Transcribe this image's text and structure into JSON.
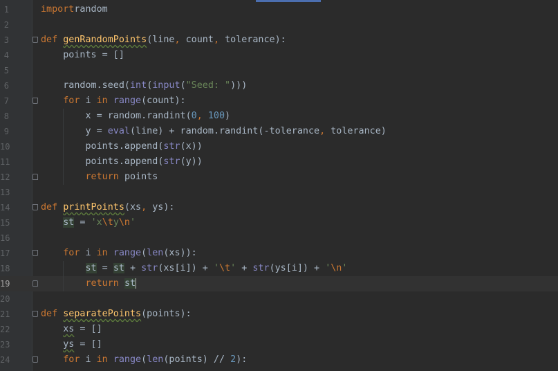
{
  "editor": {
    "language": "python",
    "current_line": 19,
    "colors": {
      "background": "#2b2b2b",
      "keyword": "#cc7832",
      "function": "#ffc66d",
      "number": "#6897bb",
      "string": "#6a8759",
      "builtin": "#8888c6",
      "text": "#a9b7c6"
    },
    "lines": [
      {
        "n": "1",
        "t": [
          [
            "kw",
            "import"
          ],
          [
            "",
            "random"
          ]
        ]
      },
      {
        "n": "2",
        "t": []
      },
      {
        "n": "3",
        "t": [
          [
            "kw",
            "def "
          ],
          [
            "fn uw",
            "genRandomPoints"
          ],
          [
            "",
            "(line"
          ],
          [
            "pu",
            ", "
          ],
          [
            "",
            "count"
          ],
          [
            "pu",
            ", "
          ],
          [
            "",
            "tolerance):"
          ]
        ]
      },
      {
        "n": "4",
        "t": [
          [
            "",
            "    points = []"
          ]
        ]
      },
      {
        "n": "5",
        "t": []
      },
      {
        "n": "6",
        "t": [
          [
            "",
            "    random.seed("
          ],
          [
            "bi",
            "int"
          ],
          [
            "",
            "("
          ],
          [
            "bi",
            "input"
          ],
          [
            "",
            "("
          ],
          [
            "str",
            "\"Seed: \""
          ],
          [
            "",
            ")))"
          ]
        ]
      },
      {
        "n": "7",
        "t": [
          [
            "kw",
            "    for "
          ],
          [
            "",
            "i "
          ],
          [
            "kw",
            "in "
          ],
          [
            "bi",
            "range"
          ],
          [
            "",
            "(count):"
          ]
        ]
      },
      {
        "n": "8",
        "t": [
          [
            "",
            "        x = random.randint("
          ],
          [
            "num",
            "0"
          ],
          [
            "pu",
            ", "
          ],
          [
            "num",
            "100"
          ],
          [
            "",
            ")"
          ]
        ]
      },
      {
        "n": "9",
        "t": [
          [
            "",
            "        y = "
          ],
          [
            "bi",
            "eval"
          ],
          [
            "",
            "(line) + random.randint(-tolerance"
          ],
          [
            "pu",
            ", "
          ],
          [
            "",
            "tolerance)"
          ]
        ]
      },
      {
        "n": "10",
        "t": [
          [
            "",
            "        points.append("
          ],
          [
            "bi",
            "str"
          ],
          [
            "",
            "(x))"
          ]
        ]
      },
      {
        "n": "11",
        "t": [
          [
            "",
            "        points.append("
          ],
          [
            "bi",
            "str"
          ],
          [
            "",
            "(y))"
          ]
        ]
      },
      {
        "n": "12",
        "t": [
          [
            "kw",
            "        return "
          ],
          [
            "",
            "points"
          ]
        ]
      },
      {
        "n": "13",
        "t": []
      },
      {
        "n": "14",
        "t": [
          [
            "kw",
            "def "
          ],
          [
            "fn uw",
            "printPoints"
          ],
          [
            "",
            "(xs"
          ],
          [
            "pu",
            ", "
          ],
          [
            "",
            "ys):"
          ]
        ]
      },
      {
        "n": "15",
        "t": [
          [
            "",
            "    "
          ],
          [
            "hl",
            "st"
          ],
          [
            "",
            " = "
          ],
          [
            "str",
            "'x"
          ],
          [
            "esc",
            "\\t"
          ],
          [
            "str",
            "y"
          ],
          [
            "esc",
            "\\n"
          ],
          [
            "str",
            "'"
          ]
        ]
      },
      {
        "n": "16",
        "t": []
      },
      {
        "n": "17",
        "t": [
          [
            "kw",
            "    for "
          ],
          [
            "",
            "i "
          ],
          [
            "kw",
            "in "
          ],
          [
            "bi",
            "range"
          ],
          [
            "",
            "("
          ],
          [
            "bi",
            "len"
          ],
          [
            "",
            "(xs)):"
          ]
        ]
      },
      {
        "n": "18",
        "t": [
          [
            "",
            "        "
          ],
          [
            "hl",
            "st"
          ],
          [
            "",
            " = "
          ],
          [
            "hl",
            "st"
          ],
          [
            "",
            " + "
          ],
          [
            "bi",
            "str"
          ],
          [
            "",
            "(xs[i]) + "
          ],
          [
            "str",
            "'"
          ],
          [
            "esc",
            "\\t"
          ],
          [
            "str",
            "'"
          ],
          [
            "",
            " + "
          ],
          [
            "bi",
            "str"
          ],
          [
            "",
            "(ys[i]) + "
          ],
          [
            "str",
            "'"
          ],
          [
            "esc",
            "\\n"
          ],
          [
            "str",
            "'"
          ]
        ]
      },
      {
        "n": "19",
        "t": [
          [
            "kw",
            "        return "
          ],
          [
            "hl",
            "st"
          ]
        ]
      },
      {
        "n": "20",
        "t": []
      },
      {
        "n": "21",
        "t": [
          [
            "kw",
            "def "
          ],
          [
            "fn uw",
            "separatePoints"
          ],
          [
            "",
            "(points):"
          ]
        ]
      },
      {
        "n": "22",
        "t": [
          [
            "",
            "    "
          ],
          [
            "uw",
            "xs"
          ],
          [
            "",
            " = []"
          ]
        ]
      },
      {
        "n": "23",
        "t": [
          [
            "",
            "    "
          ],
          [
            "uw",
            "ys"
          ],
          [
            "",
            " = []"
          ]
        ]
      },
      {
        "n": "24",
        "t": [
          [
            "kw",
            "    for "
          ],
          [
            "",
            "i "
          ],
          [
            "kw",
            "in "
          ],
          [
            "bi",
            "range"
          ],
          [
            "",
            "("
          ],
          [
            "bi",
            "len"
          ],
          [
            "",
            "(points) // "
          ],
          [
            "num",
            "2"
          ],
          [
            "",
            "):"
          ]
        ]
      }
    ]
  }
}
